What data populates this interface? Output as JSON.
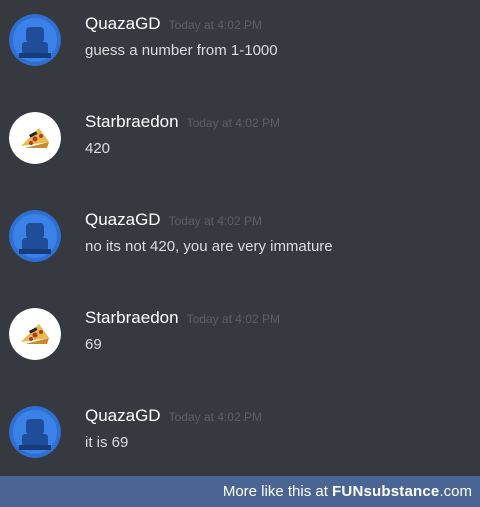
{
  "messages": [
    {
      "username": "QuazaGD",
      "timestamp": "Today at 4:02 PM",
      "text": "guess a number from 1-1000",
      "avatar": "quaza-avatar-icon"
    },
    {
      "username": "Starbraedon",
      "timestamp": "Today at 4:02 PM",
      "text": "420",
      "avatar": "starbraedon-avatar-icon"
    },
    {
      "username": "QuazaGD",
      "timestamp": "Today at 4:02 PM",
      "text": "no its not 420, you are very immature",
      "avatar": "quaza-avatar-icon"
    },
    {
      "username": "Starbraedon",
      "timestamp": "Today at 4:02 PM",
      "text": "69",
      "avatar": "starbraedon-avatar-icon"
    },
    {
      "username": "QuazaGD",
      "timestamp": "Today at 4:02 PM",
      "text": "it is 69",
      "avatar": "quaza-avatar-icon"
    }
  ],
  "footer": {
    "prefix": "More like this at ",
    "brand": "FUNsubstance",
    "suffix": ".com"
  },
  "colors": {
    "background": "#36393f",
    "footer": "#4a6594",
    "quaza_avatar": "#2f6fd1",
    "starbraedon_avatar": "#ffffff"
  }
}
